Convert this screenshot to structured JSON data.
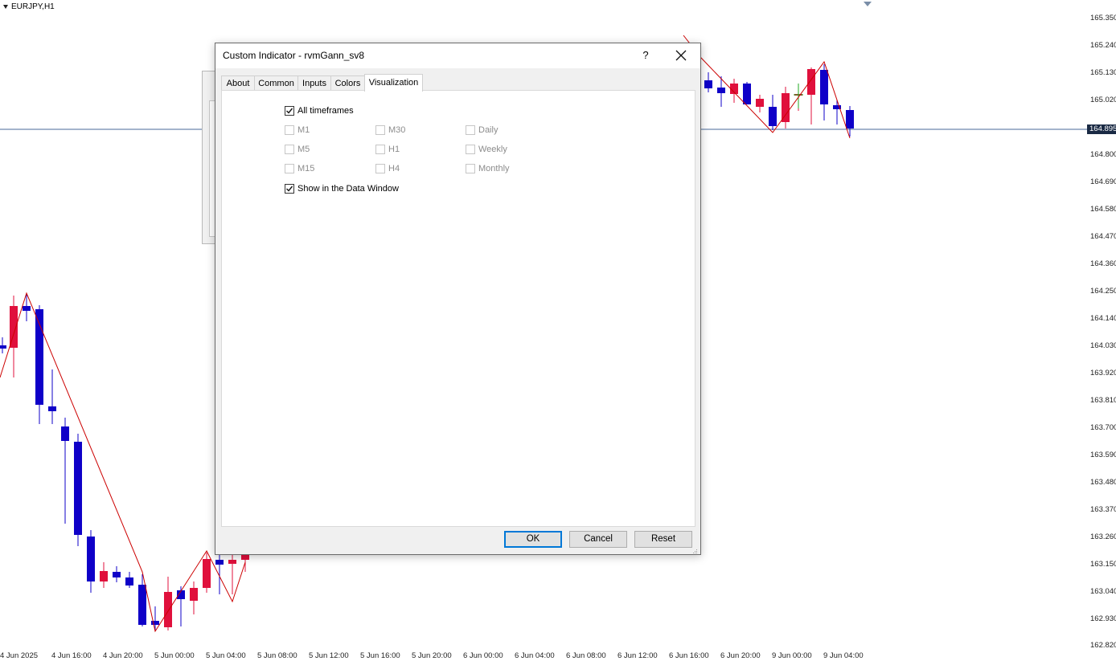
{
  "chart": {
    "symbol": "EURJPY,H1",
    "current_price": "164.895",
    "price_ticks": [
      "165.350",
      "165.240",
      "165.130",
      "165.020",
      "164.800",
      "164.690",
      "164.580",
      "164.470",
      "164.360",
      "164.250",
      "164.140",
      "164.030",
      "163.920",
      "163.810",
      "163.700",
      "163.590",
      "163.480",
      "163.370",
      "163.260",
      "163.150",
      "163.040",
      "162.930",
      "162.820"
    ],
    "time_ticks": [
      "4 Jun 2025",
      "4 Jun 16:00",
      "4 Jun 20:00",
      "5 Jun 00:00",
      "5 Jun 04:00",
      "5 Jun 08:00",
      "5 Jun 12:00",
      "5 Jun 16:00",
      "5 Jun 20:00",
      "6 Jun 00:00",
      "6 Jun 04:00",
      "6 Jun 08:00",
      "6 Jun 12:00",
      "6 Jun 16:00",
      "6 Jun 20:00",
      "9 Jun 00:00",
      "9 Jun 04:00"
    ],
    "colors": {
      "bull": "#e0103c",
      "bear": "#0f00c8",
      "zigzag": "#cc0000",
      "price_line": "#4a6a9a"
    }
  },
  "dialog": {
    "title": "Custom Indicator - rvmGann_sv8",
    "help_label": "?",
    "tabs": [
      {
        "label": "About",
        "active": false
      },
      {
        "label": "Common",
        "active": false
      },
      {
        "label": "Inputs",
        "active": false
      },
      {
        "label": "Colors",
        "active": false
      },
      {
        "label": "Visualization",
        "active": true
      }
    ],
    "visualization": {
      "all_timeframes": {
        "label": "All timeframes",
        "checked": true
      },
      "timeframes": [
        {
          "label": "M1",
          "checked": false,
          "enabled": false
        },
        {
          "label": "M30",
          "checked": false,
          "enabled": false
        },
        {
          "label": "Daily",
          "checked": false,
          "enabled": false
        },
        {
          "label": "M5",
          "checked": false,
          "enabled": false
        },
        {
          "label": "H1",
          "checked": false,
          "enabled": false
        },
        {
          "label": "Weekly",
          "checked": false,
          "enabled": false
        },
        {
          "label": "M15",
          "checked": false,
          "enabled": false
        },
        {
          "label": "H4",
          "checked": false,
          "enabled": false
        },
        {
          "label": "Monthly",
          "checked": false,
          "enabled": false
        }
      ],
      "show_in_data_window": {
        "label": "Show in the Data Window",
        "checked": true
      }
    },
    "buttons": {
      "ok": "OK",
      "cancel": "Cancel",
      "reset": "Reset"
    }
  }
}
